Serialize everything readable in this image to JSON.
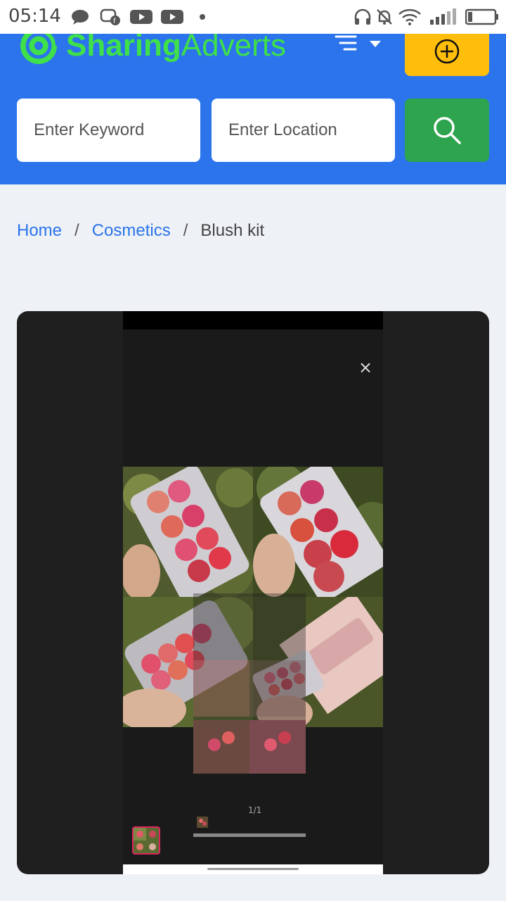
{
  "status_bar": {
    "time": "05:14"
  },
  "header": {
    "brand": {
      "part1": "Sharing",
      "part2": "Adverts"
    },
    "search": {
      "keyword_placeholder": "Enter Keyword",
      "location_placeholder": "Enter Location"
    }
  },
  "breadcrumb": {
    "items": [
      "Home",
      "Cosmetics"
    ],
    "current": "Blush kit",
    "separator": "/"
  },
  "viewer": {
    "counter": "1/1",
    "close_glyph": "×"
  },
  "colors": {
    "header_bg": "#2b74eb",
    "add_button": "#ffbe0b",
    "search_button": "#2ea44f",
    "brand_green": "#3fe04a",
    "link": "#2b74eb"
  }
}
